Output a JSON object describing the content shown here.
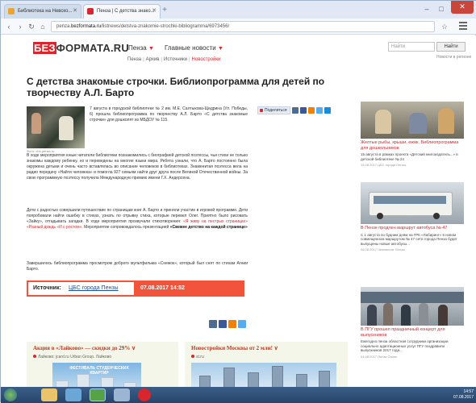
{
  "browser": {
    "tabs": [
      {
        "label": "Библиотека на Невско...",
        "active": false,
        "favicon_color": "#e9a52c"
      },
      {
        "label": "Пенза | С детства знако...",
        "active": true,
        "favicon_color": "#d7262d"
      }
    ],
    "new_tab_icon": "plus-icon",
    "url_prefix": "penza.",
    "url_domain": "bezformata.ru",
    "url_path": "/listnews/detstva-znakomie-strochki-bibliogramma/6973456/",
    "window_controls": [
      "–",
      "□",
      "✕"
    ]
  },
  "site": {
    "logo_red": "БЕЗ",
    "logo_rest": "ФОРМАТА.RU",
    "city": "Пенза",
    "news_menu": "Главные новости",
    "search_placeholder": "Найти",
    "search_button": "Найти",
    "top_link": "Новости в регионе",
    "breadcrumbs": [
      "Пенза",
      "Архив",
      "Источники",
      "Новостройки"
    ]
  },
  "article": {
    "title": "С детства знакомые строчки. Библиопрограмма для детей по творчеству А.Л. Барто",
    "photo_caption": "Фото: cbs.penza.ru",
    "intro": "7 августа в городской библиотеке № 2 им. М.Е. Салтыкова-Щедрина (Ул. Победы, 6) прошла библиопрограмма по творчеству А.Л. Барто «С детства знакомые строчки» для дошколят из МБДОУ № 115.",
    "p1": "В ходе мероприятия юные читатели библиотеки познакомились с биографией детской поэтессы, чьи стихи не только знакомы каждому ребенку, но и переведены на многие языки мира. Ребята узнали, что А. Барто постоянно была окружена детьми и очень часто вставлялась во описание человеков в библиотеках. Знаменитая поэтесса вела на радио передачу «Найти человека» и помогла 927 семьям найти друг друга после Великой Отечественной войны. За свою программную поэтессу получила Международную премию имени Г.Х. Андерсена.",
    "p2_a": "Дети с радостью совершили путешествие по страницам книг А. Барто и приняли участие в игровой программе. Дети попробовали найти ошибку в стихах, узнать по отрывку стиха, которые перевел Олег. Приятно было рисовать «Зайку», отгадывать загадки. В ходе мероприятия прозвучали стихотворения: ",
    "p2_links": "«Я живу на пестрых страницах» «Разный дождь «И с ростом»",
    "p2_b": ". Мероприятие сопровождалось презентацией ",
    "p2_bold": "«Свежее детство на каждой странице»",
    "p3": "Завершилось библиопрограмма просмотром доброго мультфильма «Снежок», который был снят по стихам Агнии Барто.",
    "share_label": "Поделиться",
    "share_icons": [
      {
        "name": "vk-share-icon",
        "color": "#4c6c91"
      },
      {
        "name": "fb-share-icon",
        "color": "#3b5998"
      },
      {
        "name": "ok-share-icon",
        "color": "#ee8208"
      },
      {
        "name": "twitter-share-icon",
        "color": "#55acee"
      },
      {
        "name": "mail-share-icon",
        "color": "#168de2"
      }
    ],
    "source_label": "Источник:",
    "source_value": "ЦБС города Пензы",
    "source_date": "07.08.2017  14:52",
    "bottom_share_icons": [
      {
        "name": "vk-icon",
        "color": "#4c6c91"
      },
      {
        "name": "fb-icon",
        "color": "#3b5998"
      },
      {
        "name": "ok-icon",
        "color": "#ee8208"
      },
      {
        "name": "twitter-icon",
        "color": "#55acee"
      }
    ]
  },
  "ads": [
    {
      "headline": "Акция в «Лайково» — скидки до 29% ∨",
      "sub": "Лайково: jcard.ru Urban Group. Лайково",
      "image_text": "ФЕСТИВАЛЬ СТУДЕНЧЕСКИХ КВАРТИР"
    },
    {
      "headline": "Новостройки Москвы от 2 млн! ∨",
      "sub": "st.ru"
    }
  ],
  "sidebar": [
    {
      "caption": "Желтые рыбы, крыши, ежик. Библиопрограмма для дошкольников",
      "desc": "15 августа в рамках проекта «Детский книгоиздатель...» в детской библиотеке № 24",
      "meta": "15.08.2017  ЦБС города Пензы"
    },
    {
      "caption": "В Пензе продлен маршрут автобуса № 47",
      "desc": "С 1 августа по будним дням на ГРК «Лабиринт» в новом совмещенном маршрутом № 47 сети города Пенза будет выпущены новые автобусы...",
      "meta": "08.08.2017  Чемпионат Пензы"
    },
    {
      "caption": "В ПГУ прошел праздничный концерт для выпускников",
      "desc": "Ежегодно пенза областная сотрудники организации социально адаптационных услуг ПГУ поздравили выпускников 2017 года...",
      "meta": "04.08.2017  Пенза Online"
    }
  ],
  "taskbar": {
    "start_icon": "windows-start-icon",
    "apps": [
      {
        "name": "explorer-taskbar-icon",
        "color": "#e9c46a"
      },
      {
        "name": "media-taskbar-icon",
        "color": "#6aa6d6"
      },
      {
        "name": "chrome-taskbar-icon",
        "color": "#56a246"
      },
      {
        "name": "app-taskbar-icon",
        "color": "#9cb5d3"
      },
      {
        "name": "opera-taskbar-icon",
        "color": "#d7262d"
      }
    ],
    "clock": "14:57",
    "date": "07.08.2017"
  }
}
